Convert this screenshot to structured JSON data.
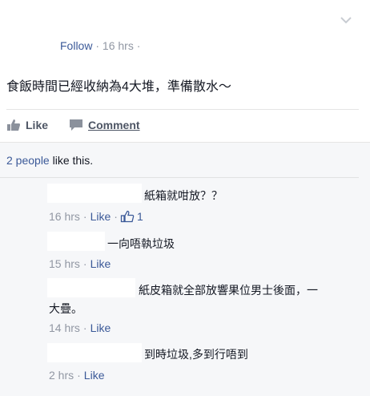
{
  "post": {
    "follow_label": "Follow",
    "sep1": "·",
    "time": "16 hrs",
    "sep2": "·",
    "text": "食飯時間已經收納為4大堆，準備散水～"
  },
  "actions": {
    "like_label": "Like",
    "comment_label": "Comment"
  },
  "likes": {
    "people": "2 people",
    "suffix": " like this."
  },
  "comments": [
    {
      "text": "紙箱就咁放？？",
      "time": "16 hrs",
      "sep": "·",
      "like_label": "Like",
      "like_count": "1"
    },
    {
      "text": "一向唔執垃圾",
      "time": "15 hrs",
      "sep": "·",
      "like_label": "Like"
    },
    {
      "text_line1": "紙皮箱就全部放響果位男士後面，一",
      "text_line2": "大疊。",
      "time": "14 hrs",
      "sep": "·",
      "like_label": "Like"
    },
    {
      "text": "到時垃圾,多到行唔到",
      "time": "2 hrs",
      "sep": "·",
      "like_label": "Like"
    }
  ],
  "colors": {
    "link": "#3b5998",
    "meta": "#9197a3",
    "text": "#141823",
    "feed_bg": "#f6f7f9"
  },
  "icons": {
    "menu": "chevron-down-icon",
    "like": "thumbs-up-icon",
    "comment": "speech-bubble-icon",
    "comment_like": "thumbs-up-outline-icon"
  }
}
